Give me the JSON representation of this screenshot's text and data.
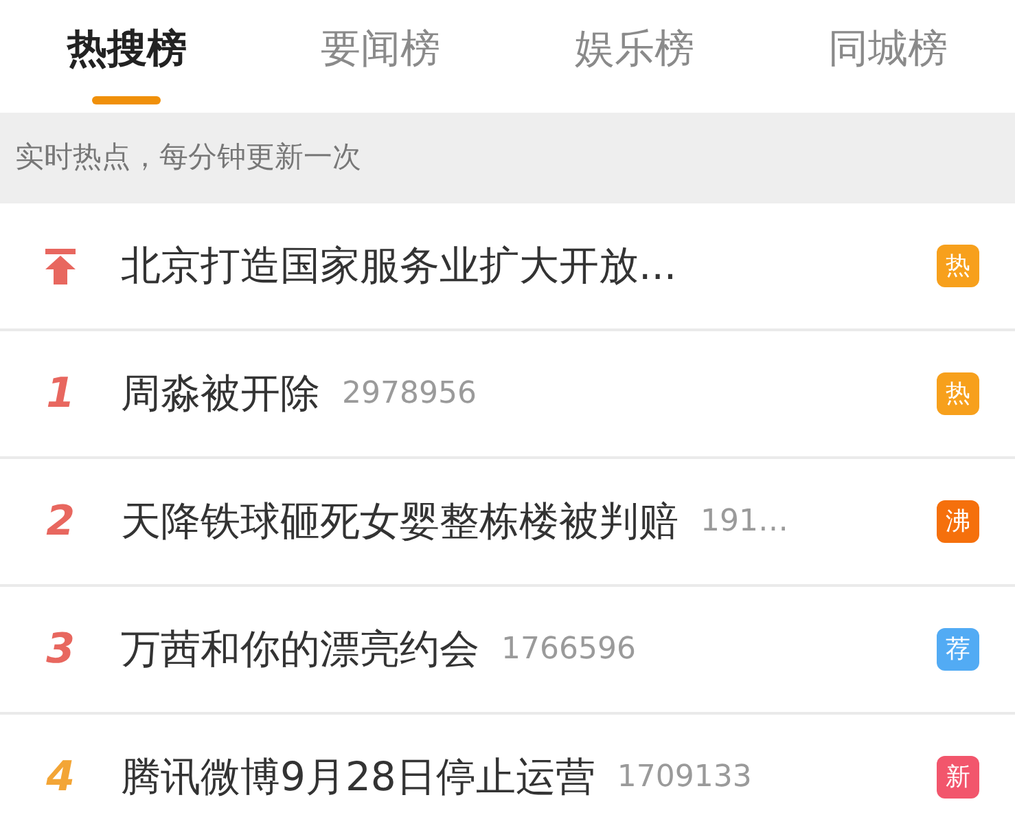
{
  "tabs": [
    {
      "label": "热搜榜",
      "selected": true
    },
    {
      "label": "要闻榜",
      "selected": false
    },
    {
      "label": "娱乐榜",
      "selected": false
    },
    {
      "label": "同城榜",
      "selected": false
    }
  ],
  "notice": "实时热点，每分钟更新一次",
  "items": [
    {
      "kind": "pinned",
      "title": "北京打造国家服务业扩大开放...",
      "badge": {
        "label": "热",
        "color": "#f7a01c"
      }
    },
    {
      "kind": "ranked",
      "rank": "1",
      "color": "#e8675f",
      "title": "周淼被开除",
      "count": "2978956",
      "badge": {
        "label": "热",
        "color": "#f7a01c"
      }
    },
    {
      "kind": "ranked",
      "rank": "2",
      "color": "#e8675f",
      "title": "天降铁球砸死女婴整栋楼被判赔",
      "count": "191…",
      "badge": {
        "label": "沸",
        "color": "#f5700c"
      }
    },
    {
      "kind": "ranked",
      "rank": "3",
      "color": "#e8675f",
      "title": "万茜和你的漂亮约会",
      "count": "1766596",
      "badge": {
        "label": "荐",
        "color": "#52abf4"
      }
    },
    {
      "kind": "ranked",
      "rank": "4",
      "color": "#f3a536",
      "title": "腾讯微博9月28日停止运营",
      "count": "1709133",
      "badge": {
        "label": "新",
        "color": "#f2566c"
      }
    }
  ]
}
